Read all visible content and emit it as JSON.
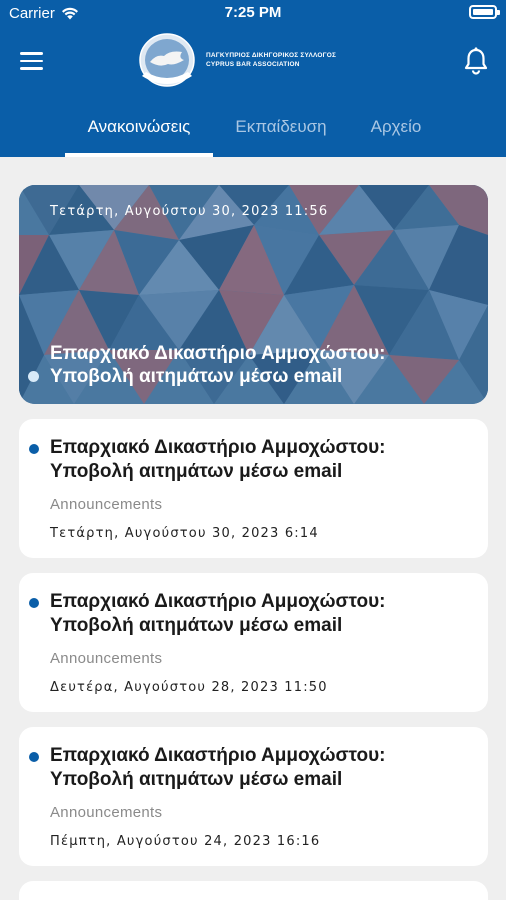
{
  "status": {
    "carrier": "Carrier",
    "time": "7:25 PM"
  },
  "header": {
    "logo_line1": "ΠΑΓΚΥΠΡΙΟΣ ΔΙΚΗΓΟΡΙΚΟΣ ΣΥΛΛΟΓΟΣ",
    "logo_line2": "CYPRUS BAR ASSOCIATION"
  },
  "tabs": [
    {
      "label": "Ανακοινώσεις",
      "active": true
    },
    {
      "label": "Εκπαίδευση",
      "active": false
    },
    {
      "label": "Αρχείο",
      "active": false
    }
  ],
  "featured": {
    "date": "Τετάρτη, Αυγούστου 30, 2023 11:56",
    "title": "Επαρχιακό Δικαστήριο Αμμοχώστου: Υποβολή αιτημάτων μέσω email"
  },
  "cards": [
    {
      "title": "Επαρχιακό Δικαστήριο Αμμοχώστου: Υποβολή αιτημάτων μέσω email",
      "category": "Announcements",
      "date": "Τετάρτη, Αυγούστου 30, 2023 6:14"
    },
    {
      "title": "Επαρχιακό Δικαστήριο Αμμοχώστου: Υποβολή αιτημάτων μέσω email",
      "category": "Announcements",
      "date": "Δευτέρα, Αυγούστου 28, 2023 11:50"
    },
    {
      "title": "Επαρχιακό Δικαστήριο Αμμοχώστου: Υποβολή αιτημάτων μέσω email",
      "category": "Announcements",
      "date": "Πέμπτη, Αυγούστου 24, 2023 16:16"
    }
  ],
  "colors": {
    "brand": "#0a5ea8",
    "unread_dot": "#0a5ea8",
    "background": "#efefef"
  },
  "icons": {
    "menu": "hamburger-menu-icon",
    "notifications": "bell-icon",
    "wifi": "wifi-icon",
    "battery": "battery-icon"
  }
}
